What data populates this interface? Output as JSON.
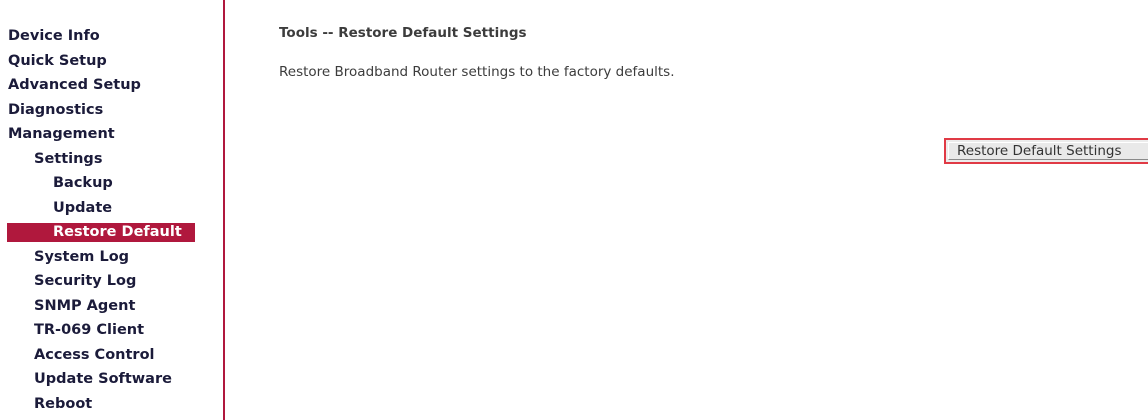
{
  "sidebar": {
    "items": [
      {
        "label": "Device Info",
        "level": 0,
        "active": false
      },
      {
        "label": "Quick Setup",
        "level": 0,
        "active": false
      },
      {
        "label": "Advanced Setup",
        "level": 0,
        "active": false
      },
      {
        "label": "Diagnostics",
        "level": 0,
        "active": false
      },
      {
        "label": "Management",
        "level": 0,
        "active": false
      },
      {
        "label": "Settings",
        "level": 1,
        "active": false
      },
      {
        "label": "Backup",
        "level": 2,
        "active": false
      },
      {
        "label": "Update",
        "level": 2,
        "active": false
      },
      {
        "label": "Restore Default",
        "level": 2,
        "active": true
      },
      {
        "label": "System Log",
        "level": 1,
        "active": false
      },
      {
        "label": "Security Log",
        "level": 1,
        "active": false
      },
      {
        "label": "SNMP Agent",
        "level": 1,
        "active": false
      },
      {
        "label": "TR-069 Client",
        "level": 1,
        "active": false
      },
      {
        "label": "Access Control",
        "level": 1,
        "active": false
      },
      {
        "label": "Update Software",
        "level": 1,
        "active": false
      },
      {
        "label": "Reboot",
        "level": 1,
        "active": false
      }
    ]
  },
  "main": {
    "title": "Tools -- Restore Default Settings",
    "description": "Restore Broadband Router settings to the factory defaults.",
    "restore_button_label": "Restore Default Settings"
  },
  "colors": {
    "accent": "#b0183d",
    "button_highlight_border": "#e03a45",
    "nav_text": "#1b1b3a",
    "body_text": "#3c3c3c"
  }
}
